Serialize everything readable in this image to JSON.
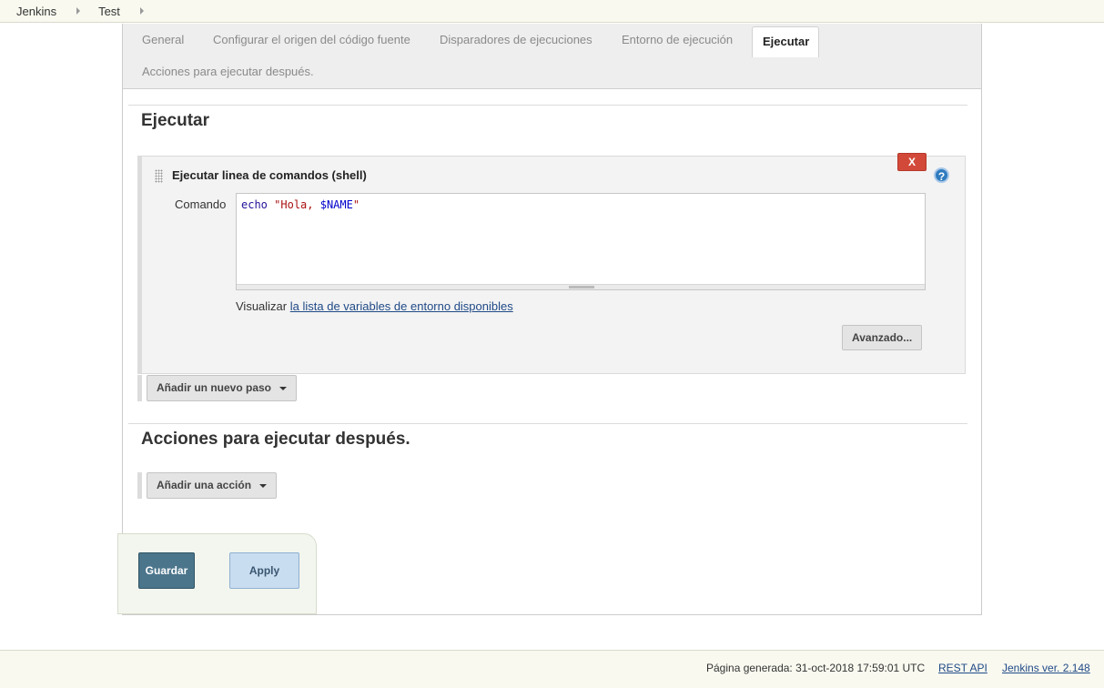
{
  "breadcrumb": {
    "items": [
      "Jenkins",
      "Test"
    ]
  },
  "tabs": {
    "general": "General",
    "scm": "Configurar el origen del código fuente",
    "triggers": "Disparadores de ejecuciones",
    "environment": "Entorno de ejecución",
    "build": "Ejecutar",
    "post_build": "Acciones para ejecutar después.",
    "active": "build"
  },
  "build_section": {
    "title": "Ejecutar",
    "step": {
      "title": "Ejecutar linea de comandos (shell)",
      "delete_label": "X",
      "help_label": "?",
      "command_label": "Comando",
      "command_tokens": {
        "cmd": "echo",
        "space": " ",
        "str_open": "\"Hola, ",
        "var": "$NAME",
        "str_close": "\""
      },
      "env_prefix": "Visualizar",
      "env_link": "la lista de variables de entorno disponibles",
      "advanced_label": "Avanzado..."
    },
    "add_step_label": "Añadir un nuevo paso"
  },
  "post_build_section": {
    "title": "Acciones para ejecutar después.",
    "add_action_label": "Añadir una acción"
  },
  "buttons": {
    "save": "Guardar",
    "apply": "Apply"
  },
  "footer": {
    "generated": "Página generada: 31-oct-2018 17:59:01 UTC",
    "rest_api": "REST API",
    "version": "Jenkins ver. 2.148"
  },
  "colors": {
    "save": "#4b758b",
    "apply": "#c9ddf0",
    "delete": "#d24939",
    "link": "#204a87"
  }
}
